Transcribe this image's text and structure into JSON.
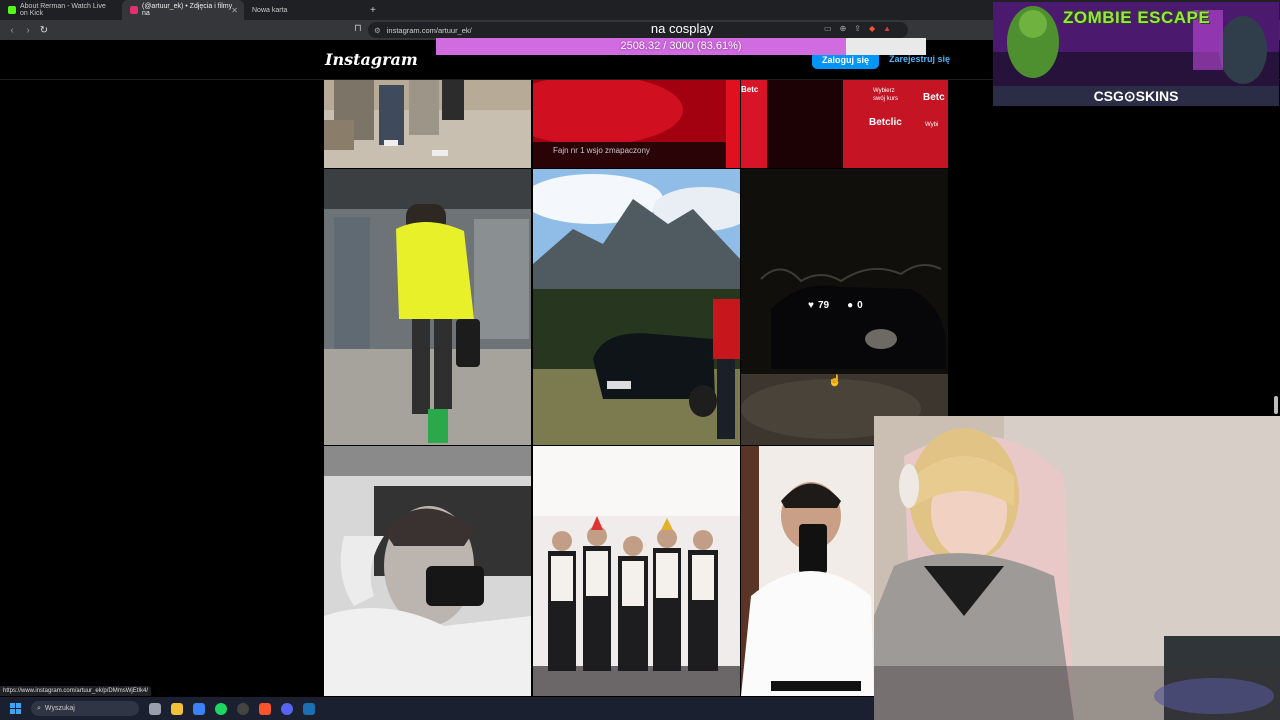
{
  "browser": {
    "tabs": [
      {
        "title": "About Rerman - Watch Live on Kick",
        "favicon_color": "#53fc18",
        "active": false
      },
      {
        "title": "(@artuur_ek) • Zdjęcia i filmy na",
        "favicon_color": "#e1306c",
        "active": true
      },
      {
        "title": "Nowa karta",
        "favicon_color": "",
        "active": false
      }
    ],
    "new_tab_symbol": "+",
    "url": "instagram.com/artuur_ek/",
    "status_url": "https://www.instagram.com/artuur_ek/p/DMmsWjEtIk4/"
  },
  "overlay": {
    "title": "na cosplay",
    "progress_label": "2508.32 / 3000 (83.61%)",
    "progress_fraction": 0.8361,
    "fill_color": "#d06be0"
  },
  "instagram": {
    "logo": "Instagram",
    "login_label": "Zaloguj się",
    "signup_label": "Zarejestruj się",
    "hover_post": {
      "likes": "79",
      "comments": "0"
    },
    "posts": [
      {
        "name": "post-group-sitting",
        "description_icon": "photo"
      },
      {
        "name": "post-red-betclic-1",
        "description_icon": "photo"
      },
      {
        "name": "post-red-betclic-2",
        "description_icon": "photo"
      },
      {
        "name": "post-yellow-hoodie",
        "description_icon": "photo"
      },
      {
        "name": "post-mountains-car",
        "description_icon": "photo"
      },
      {
        "name": "post-night-car",
        "description_icon": "photo"
      },
      {
        "name": "post-mirror-selfie",
        "description_icon": "photo"
      },
      {
        "name": "post-group-party",
        "description_icon": "photo"
      },
      {
        "name": "post-phone-selfie",
        "description_icon": "photo"
      }
    ],
    "betclic_text": [
      "Betclic",
      "Wybierz swój kurs",
      "Betc"
    ]
  },
  "ad": {
    "title": "ZOMBIE ESCAPE",
    "brand": "CSG⊙SKINS"
  },
  "taskbar": {
    "search_placeholder": "Wyszukaj"
  }
}
